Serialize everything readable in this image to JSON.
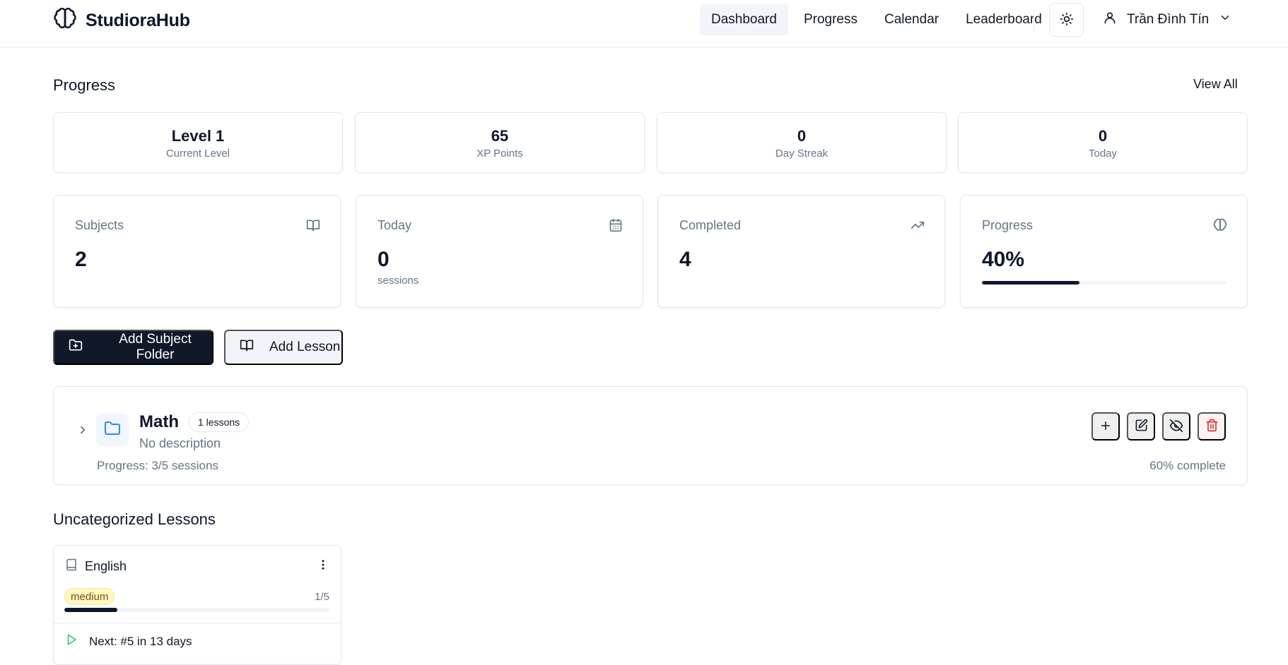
{
  "app": {
    "name": "StudioraHub",
    "logo_icon": "brain-icon"
  },
  "nav": {
    "items": [
      {
        "label": "Dashboard",
        "active": true
      },
      {
        "label": "Progress",
        "active": false
      },
      {
        "label": "Calendar",
        "active": false
      },
      {
        "label": "Leaderboard",
        "active": false
      }
    ],
    "theme_icon": "sun-icon",
    "user": {
      "name": "Trần Đình Tín",
      "icon": "user-icon",
      "menu_icon": "chevron-down-icon"
    }
  },
  "progress_section": {
    "title": "Progress",
    "view_all_label": "View All",
    "stats": [
      {
        "value": "Level 1",
        "label": "Current Level"
      },
      {
        "value": "65",
        "label": "XP Points"
      },
      {
        "value": "0",
        "label": "Day Streak"
      },
      {
        "value": "0",
        "label": "Today"
      }
    ]
  },
  "metrics": {
    "subjects": {
      "title": "Subjects",
      "value": "2",
      "icon": "book-open-icon"
    },
    "today": {
      "title": "Today",
      "value": "0",
      "sub": "sessions",
      "icon": "calendar-icon"
    },
    "completed": {
      "title": "Completed",
      "value": "4",
      "icon": "trending-up-icon"
    },
    "progress": {
      "title": "Progress",
      "value": "40%",
      "fraction": 0.4,
      "icon": "brain-icon"
    }
  },
  "actions": {
    "add_folder_label": "Add Subject Folder",
    "add_lesson_label": "Add Lesson"
  },
  "folders": [
    {
      "name": "Math",
      "badge": "1 lessons",
      "description": "No description",
      "progress_text": "Progress: 3/5 sessions",
      "complete_text": "60% complete"
    }
  ],
  "uncategorized": {
    "title": "Uncategorized Lessons",
    "lessons": [
      {
        "name": "English",
        "difficulty": "medium",
        "count": "1/5",
        "fraction": 0.2,
        "next": "Next: #5 in 13 days"
      }
    ]
  },
  "colors": {
    "primary": "#111827",
    "muted": "#64748b",
    "folder_blue": "#3b82f6",
    "danger": "#dc2626",
    "play_green": "#22c55e",
    "badge_yellow": "#fef9c3"
  }
}
